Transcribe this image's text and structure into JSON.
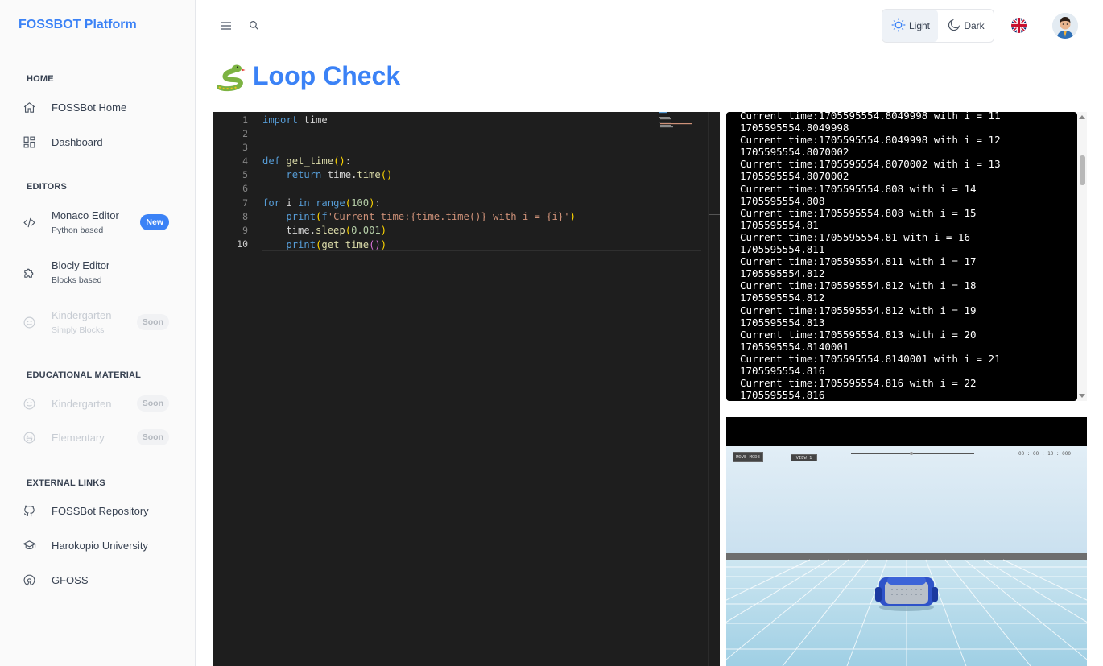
{
  "app": {
    "brand": "FOSSBOT Platform"
  },
  "sidebar": {
    "sections": [
      {
        "title": "HOME"
      },
      {
        "title": "EDITORS"
      },
      {
        "title": "EDUCATIONAL MATERIAL"
      },
      {
        "title": "EXTERNAL LINKS"
      }
    ],
    "home_items": [
      {
        "label": "FOSSBot Home",
        "icon": "home-icon"
      },
      {
        "label": "Dashboard",
        "icon": "dashboard-icon"
      }
    ],
    "editor_items": [
      {
        "label": "Monaco Editor",
        "sub": "Python based",
        "badge": "New",
        "icon": "code-icon"
      },
      {
        "label": "Blocly Editor",
        "sub": "Blocks based",
        "icon": "puzzle-icon"
      },
      {
        "label": "Kindergarten",
        "sub": "Simply Blocks",
        "badge": "Soon",
        "icon": "smile-icon"
      }
    ],
    "education_items": [
      {
        "label": "Kindergarten",
        "badge": "Soon",
        "icon": "smile-icon"
      },
      {
        "label": "Elementary",
        "badge": "Soon",
        "icon": "laugh-icon"
      }
    ],
    "external_items": [
      {
        "label": "FOSSBot Repository",
        "icon": "github-icon"
      },
      {
        "label": "Harokopio University",
        "icon": "graduation-cap-icon"
      },
      {
        "label": "GFOSS",
        "icon": "open-source-icon"
      }
    ]
  },
  "header": {
    "theme": {
      "light": "Light",
      "dark": "Dark",
      "active": "light"
    },
    "language": "en-GB"
  },
  "page": {
    "title": "Loop Check",
    "emoji": "snake"
  },
  "editor": {
    "line_numbers": [
      "1",
      "2",
      "3",
      "4",
      "5",
      "6",
      "7",
      "8",
      "9",
      "10"
    ],
    "current_line": 10,
    "lines": [
      "import time",
      "",
      "",
      "def get_time():",
      "    return time.time()",
      "",
      "for i in range(100):",
      "    print(f'Current time:{time.time()} with i = {i}')",
      "    time.sleep(0.001)",
      "    print(get_time())"
    ]
  },
  "terminal": {
    "lines": [
      "Current time:1705595554.8049998 with i = 11",
      "1705595554.8049998",
      "Current time:1705595554.8049998 with i = 12",
      "1705595554.8070002",
      "Current time:1705595554.8070002 with i = 13",
      "1705595554.8070002",
      "Current time:1705595554.808 with i = 14",
      "1705595554.808",
      "Current time:1705595554.808 with i = 15",
      "1705595554.81",
      "Current time:1705595554.81 with i = 16",
      "1705595554.811",
      "Current time:1705595554.811 with i = 17",
      "1705595554.812",
      "Current time:1705595554.812 with i = 18",
      "1705595554.812",
      "Current time:1705595554.812 with i = 19",
      "1705595554.813",
      "Current time:1705595554.813 with i = 20",
      "1705595554.8140001",
      "Current time:1705595554.8140001 with i = 21",
      "1705595554.816",
      "Current time:1705595554.816 with i = 22",
      "1705595554.816"
    ]
  },
  "simulator": {
    "hud_left": "MOVE MODE",
    "hud_mid": "VIEW 1",
    "hud_time": "00 : 00 : 10 : 000"
  },
  "colors": {
    "accent": "#3b82f6",
    "editor_bg": "#1e1e1e",
    "terminal_bg": "#000000",
    "sky": "#dbe9f3",
    "floor": "#a9d4e6"
  }
}
